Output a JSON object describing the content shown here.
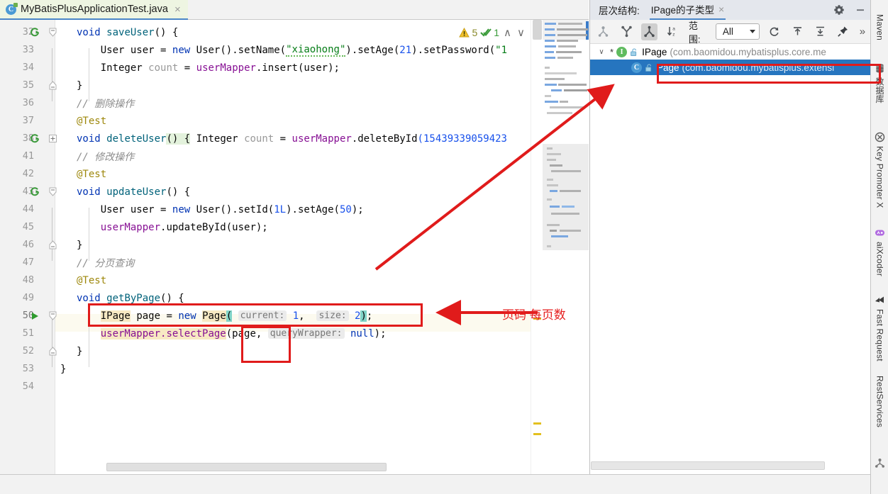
{
  "editor": {
    "tab": {
      "title": "MyBatisPlusApplicationTest.java",
      "icon": "java-class-icon",
      "close": "×"
    },
    "inspection": {
      "warning_count": "5",
      "ok_count": "1",
      "up": "∧",
      "down": "∨"
    },
    "lines": [
      {
        "num": "32",
        "runnable": true,
        "fold": "open"
      },
      {
        "num": "33"
      },
      {
        "num": "34"
      },
      {
        "num": "35",
        "fold": "end"
      },
      {
        "num": "36"
      },
      {
        "num": "37"
      },
      {
        "num": "38",
        "runnable": true,
        "fold": "collapsed"
      },
      {
        "num": "41"
      },
      {
        "num": "42"
      },
      {
        "num": "43",
        "runnable": true,
        "fold": "open"
      },
      {
        "num": "44"
      },
      {
        "num": "45"
      },
      {
        "num": "46",
        "fold": "end"
      },
      {
        "num": "47"
      },
      {
        "num": "48"
      },
      {
        "num": "49",
        "run": true,
        "fold": "open"
      },
      {
        "num": "50",
        "current": true
      },
      {
        "num": "51"
      },
      {
        "num": "52",
        "fold": "end"
      },
      {
        "num": "53"
      },
      {
        "num": "54"
      }
    ],
    "code": {
      "l32": {
        "kw": "void",
        "mth": "saveUser",
        "rest": "() {"
      },
      "l33": {
        "t1": "User",
        "v1": "user",
        "eq": "=",
        "kw": "new",
        "t2": "User",
        "m1": ".setName",
        "s1": "\"xiaohong\"",
        "m2": ".setAge",
        "n1": "21",
        "m3": ".setPassword",
        "s2": "\"1"
      },
      "l34": {
        "t1": "Integer",
        "v1": "count",
        "eq": "=",
        "f1": "userMapper",
        "m1": ".insert",
        "a1": "(user);"
      },
      "l35": {
        "text": "}"
      },
      "l36": {
        "comment": "// 删除操作"
      },
      "l37": {
        "annotation": "@Test"
      },
      "l38": {
        "kw": "void",
        "mth": "deleteUser",
        "p": "() {",
        "t1": "Integer",
        "v1": "count",
        "eq": "=",
        "f1": "userMapper",
        "m1": ".deleteById",
        "n1": "(15439339059423"
      },
      "l41": {
        "comment": "// 修改操作"
      },
      "l42": {
        "annotation": "@Test"
      },
      "l43": {
        "kw": "void",
        "mth": "updateUser",
        "rest": "() {"
      },
      "l44": {
        "t1": "User",
        "v1": "user",
        "eq": "=",
        "kw": "new",
        "t2": "User",
        "m1": ".setId",
        "n1": "1L",
        "m2": ".setAge",
        "n2": "50",
        "end": ");"
      },
      "l45": {
        "f1": "userMapper",
        "m1": ".updateById",
        "a1": "(user);"
      },
      "l46": {
        "text": "}"
      },
      "l47": {
        "comment": "// 分页查询"
      },
      "l48": {
        "annotation": "@Test"
      },
      "l49": {
        "kw": "void",
        "mth": "getByPage",
        "rest": "() {"
      },
      "l50": {
        "t1": "IPage",
        "v1": "page",
        "eq": "=",
        "kw": "new",
        "t2": "Page",
        "open": "(",
        "hint1": "current:",
        "n1": "1",
        "comma": ",",
        "hint2": "size:",
        "n2": "2",
        "close": ")",
        "semi": ";"
      },
      "l51": {
        "f1": "userMapper",
        "m1": ".selectPage",
        "a1": "(page,",
        "hint1": "queryWrapper:",
        "kw": "null",
        "end": ");"
      },
      "l52": {
        "text": "}"
      },
      "l53": {
        "text": "}"
      },
      "l54": {
        "text": ""
      }
    },
    "hscroll": {
      "name": "horizontal-scrollbar"
    }
  },
  "hierarchy": {
    "label": "层次结构:",
    "tab": "IPage的子类型",
    "tab_close": "×",
    "toolbar": {
      "buttons": [
        {
          "name": "type-hierarchy-button",
          "glyph": "type-hierarchy-icon",
          "active": false
        },
        {
          "name": "supertypes-hierarchy-button",
          "glyph": "supertypes-icon",
          "active": false
        },
        {
          "name": "subtypes-hierarchy-button",
          "glyph": "subtypes-icon",
          "active": true
        },
        {
          "name": "sort-alphabetically-button",
          "glyph": "sort-az-icon",
          "active": false
        }
      ],
      "scope_label": "范围:",
      "scope_value": "All",
      "actions": [
        {
          "name": "refresh-button",
          "glyph": "refresh-icon"
        },
        {
          "name": "expand-all-button",
          "glyph": "expand-all-icon"
        },
        {
          "name": "collapse-all-button",
          "glyph": "collapse-all-icon"
        },
        {
          "name": "pin-button",
          "glyph": "pin-icon"
        }
      ],
      "more": "»"
    },
    "tree": [
      {
        "twisty": "∨",
        "star": "*",
        "icon": "interface-icon",
        "icon_letter": "I",
        "lock": "unlocked-icon",
        "name": "IPage",
        "package": "(com.baomidou.mybatisplus.core.me",
        "selected": false
      },
      {
        "twisty": "",
        "star": "",
        "icon": "class-icon",
        "icon_letter": "C",
        "lock": "unlocked-icon",
        "name": "Page",
        "package": "(com.baomidou.mybatisplus.extensi",
        "selected": true
      }
    ],
    "gear": "settings-icon",
    "minimize": "minimize-icon"
  },
  "rail": {
    "items": [
      {
        "label": "Maven",
        "icon": "maven-icon"
      },
      {
        "label": "数据库",
        "icon": "database-icon"
      },
      {
        "label": "Key Promoter X",
        "icon": "key-promoter-icon"
      },
      {
        "label": "aiXcoder",
        "icon": "aixcoder-icon"
      },
      {
        "label": "Fast Request",
        "icon": "fast-request-icon"
      },
      {
        "label": "RestServices",
        "icon": "rest-services-icon"
      }
    ]
  },
  "annotations": {
    "note_text": "页码 每页数",
    "color": "#e62020"
  }
}
